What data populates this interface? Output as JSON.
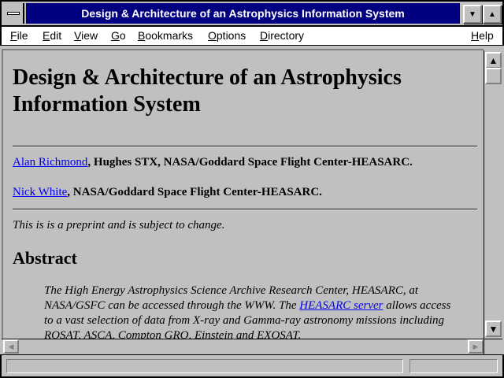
{
  "window": {
    "title": "Design & Architecture of an Astrophysics Information System"
  },
  "menu": {
    "items": [
      {
        "label": "File"
      },
      {
        "label": "Edit"
      },
      {
        "label": "View"
      },
      {
        "label": "Go"
      },
      {
        "label": "Bookmarks"
      },
      {
        "label": "Options"
      },
      {
        "label": "Directory"
      },
      {
        "label": "Help"
      }
    ]
  },
  "document": {
    "heading": "Design & Architecture of an Astrophysics Information System",
    "authors": [
      {
        "name": "Alan Richmond",
        "affiliation": ", Hughes STX, NASA/Goddard Space Flight Center-HEASARC."
      },
      {
        "name": "Nick White",
        "affiliation": ", NASA/Goddard Space Flight Center-HEASARC."
      }
    ],
    "note": "This is is a preprint and is subject to change.",
    "abstract_heading": "Abstract",
    "abstract": {
      "before_link": "The High Energy Astrophysics Science Archive Research Center, HEASARC, at NASA/GSFC can be accessed through the WWW. The ",
      "link": "HEASARC server",
      "after_link": " allows access to a vast selection of data from X-ray and Gamma-ray astronomy missions including ROSAT, ASCA, Compton GRO, Einstein and EXOSAT."
    }
  },
  "icons": {
    "system_menu": "system-menu-icon",
    "minimize": "minimize-icon",
    "maximize": "maximize-icon",
    "scroll_up": "arrow-up-icon",
    "scroll_down": "arrow-down-icon",
    "scroll_left": "arrow-left-icon",
    "scroll_right": "arrow-right-icon"
  },
  "colors": {
    "titlebar": "#000080",
    "background": "#c0c0c0",
    "link": "#0000ee"
  }
}
